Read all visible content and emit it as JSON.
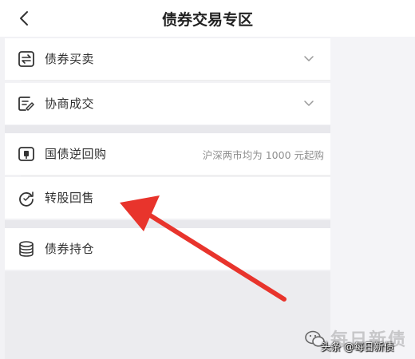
{
  "header": {
    "title": "债券交易专区",
    "back_icon": "chevron-left-icon"
  },
  "menu": {
    "bond_trading": {
      "label": "债券买卖",
      "icon": "exchange-icon",
      "expand_icon": "chevron-down-icon"
    },
    "negotiated_trade": {
      "label": "协商成交",
      "icon": "edit-document-icon",
      "expand_icon": "chevron-down-icon"
    },
    "reverse_repo": {
      "label": "国债逆回购",
      "icon": "repo-icon",
      "note": "沪深两市均为 1000 元起购"
    },
    "conversion_resale": {
      "label": "转股回售",
      "icon": "refresh-circle-icon"
    },
    "bond_holdings": {
      "label": "债券持仓",
      "icon": "database-icon"
    }
  },
  "annotation": {
    "arrow_color": "#e8342c"
  },
  "watermark": {
    "text": "头条 @每日新债",
    "faded_text": "每日新债"
  },
  "colors": {
    "background": "#f2f2f5",
    "card": "#ffffff",
    "muted_text": "#8f8f8f",
    "arrow": "#e8342c"
  }
}
